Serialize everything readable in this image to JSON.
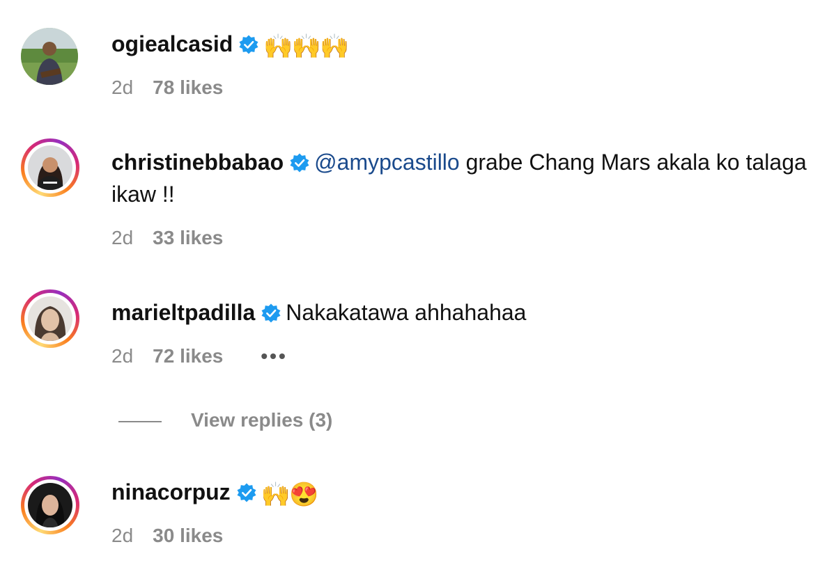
{
  "comments": [
    {
      "username": "ogiealcasid",
      "verified": true,
      "story_ring": false,
      "text": "🙌🙌🙌",
      "mention": "",
      "time": "2d",
      "likes": "78 likes"
    },
    {
      "username": "christinebbabao",
      "verified": true,
      "story_ring": true,
      "mention": "@amypcastillo",
      "text": " grabe Chang Mars akala ko talaga ikaw !!",
      "time": "2d",
      "likes": "33 likes"
    },
    {
      "username": "marieltpadilla",
      "verified": true,
      "story_ring": true,
      "mention": "",
      "text": "Nakakatawa ahhahahaa",
      "time": "2d",
      "likes": "72 likes",
      "more": "•••"
    },
    {
      "username": "ninacorpuz",
      "verified": true,
      "story_ring": true,
      "mention": "",
      "text": "🙌😍",
      "time": "2d",
      "likes": "30 likes"
    }
  ],
  "replies_link": "View replies (3)",
  "colors": {
    "verified": "#1d9bf0",
    "mention": "#1a4a8c",
    "meta": "#8a8a8a"
  }
}
